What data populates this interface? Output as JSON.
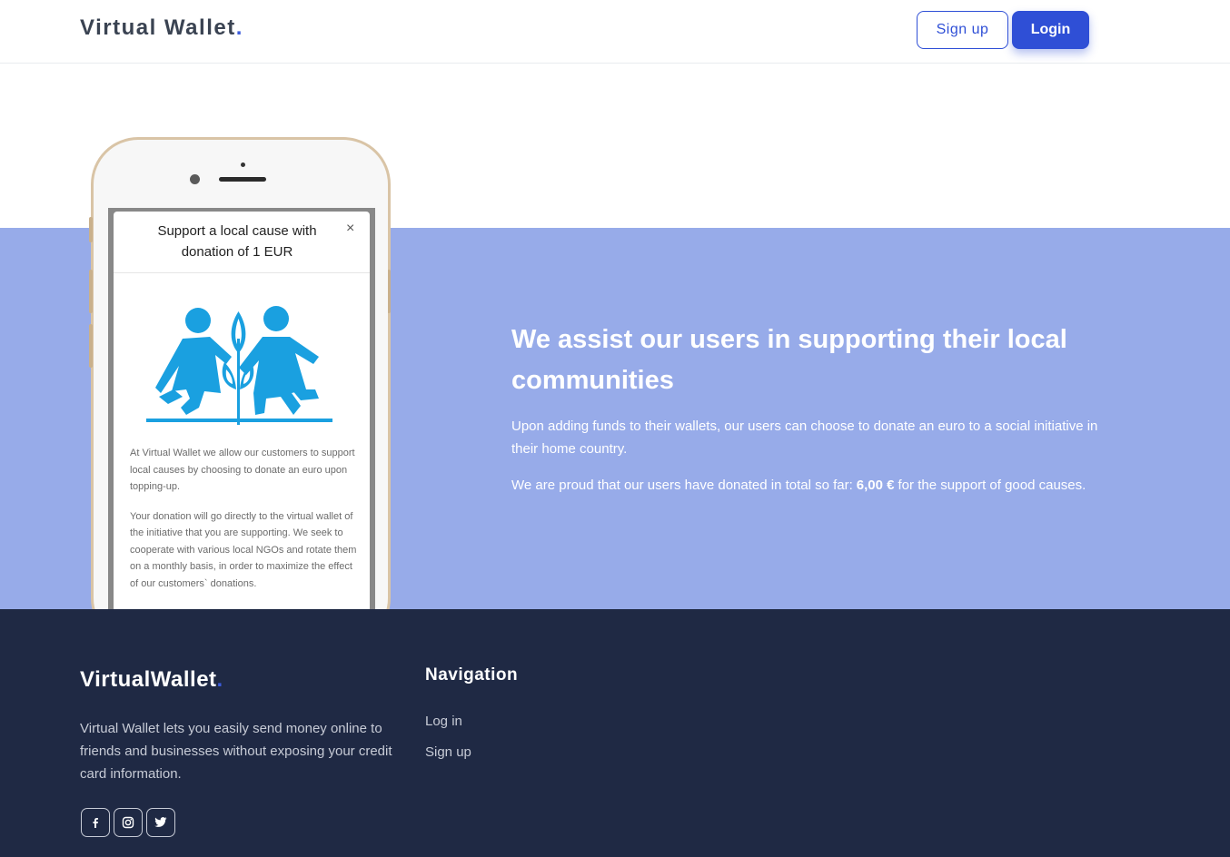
{
  "header": {
    "brand": "Virtual Wallet",
    "brand_dot": ".",
    "signup_label": "Sign up",
    "login_label": "Login"
  },
  "phone_modal": {
    "title": "Support a local cause with donation of 1 EUR",
    "close": "×",
    "paragraph1": "At Virtual Wallet we allow our customers to support local causes by choosing to donate an euro upon topping-up.",
    "paragraph2": "Your donation will go directly to the virtual wallet of the initiative that you are supporting. We seek to cooperate with various local NGOs and rotate them on a monthly basis, in order to maximize the effect of our customers` donations."
  },
  "band": {
    "title": "We assist our users in supporting their local communities",
    "paragraph1": "Upon adding funds to their wallets, our users can choose to donate an euro to a social initiative in their home country.",
    "paragraph2_prefix": "We are proud that our users have donated in total so far:",
    "total_donated": "6,00 €",
    "paragraph2_suffix": "for the support of good causes."
  },
  "footer": {
    "brand": "VirtualWallet",
    "brand_dot": ".",
    "description": "Virtual Wallet lets you easily send money online to friends and businesses without exposing your credit card information.",
    "social": [
      {
        "icon": "facebook-icon"
      },
      {
        "icon": "instagram-icon"
      },
      {
        "icon": "twitter-icon"
      }
    ],
    "nav_title": "Navigation",
    "nav_links": [
      "Log in",
      "Sign up"
    ]
  },
  "colors": {
    "primary": "#2f4fd6",
    "band": "#97abe9",
    "footer": "#1f2944",
    "logo_blue": "#1aa0e0"
  }
}
